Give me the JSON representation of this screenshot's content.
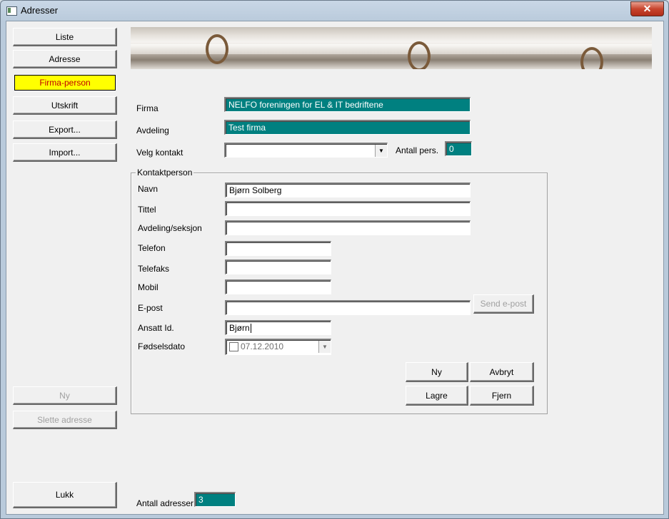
{
  "window": {
    "title": "Adresser",
    "close_glyph": "✕"
  },
  "sidebar": {
    "liste": "Liste",
    "adresse": "Adresse",
    "firma_person": "Firma-person",
    "utskrift": "Utskrift",
    "export": "Export...",
    "import": "Import...",
    "ny": "Ny",
    "slette_adresse": "Slette adresse",
    "lukk": "Lukk"
  },
  "form": {
    "firma_label": "Firma",
    "firma_value": "NELFO foreningen for EL & IT bedriftene",
    "avdeling_label": "Avdeling",
    "avdeling_value": "Test firma",
    "velg_kontakt_label": "Velg kontakt",
    "velg_kontakt_value": "",
    "antall_pers_label": "Antall pers.",
    "antall_pers_value": "0"
  },
  "contact": {
    "group_title": "Kontaktperson",
    "navn_label": "Navn",
    "navn_value": "Bjørn Solberg",
    "tittel_label": "Tittel",
    "tittel_value": "",
    "avdeling_label": "Avdeling/seksjon",
    "avdeling_value": "",
    "telefon_label": "Telefon",
    "telefon_value": "",
    "telefaks_label": "Telefaks",
    "telefaks_value": "",
    "mobil_label": "Mobil",
    "mobil_value": "",
    "epost_label": "E-post",
    "epost_value": "",
    "send_epost": "Send e-post",
    "ansatt_label": "Ansatt Id.",
    "ansatt_value": "Bjørn",
    "fodselsdato_label": "Fødselsdato",
    "fodselsdato_value": "07.12.2010",
    "ny": "Ny",
    "avbryt": "Avbryt",
    "lagre": "Lagre",
    "fjern": "Fjern"
  },
  "footer": {
    "antall_adresser_label": "Antall adresser",
    "antall_adresser_value": "3"
  },
  "colors": {
    "teal": "#008080",
    "highlight": "#ffff00",
    "highlight_text": "#c00000"
  }
}
